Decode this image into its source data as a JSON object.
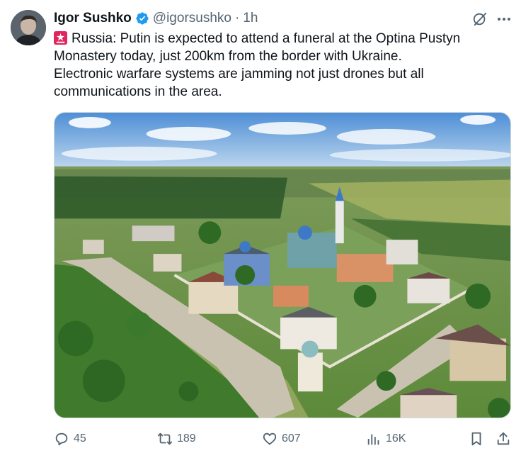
{
  "author": {
    "name": "Igor Sushko",
    "handle": "@igorsushko",
    "separator": "·",
    "time": "1h"
  },
  "tweet": {
    "lines": [
      "Russia: Putin is expected to attend a funeral at the Optina Pustyn",
      "Monastery today, just 200km from the border with Ukraine.",
      "Electronic warfare systems are jamming not just drones but all",
      "communications in the area."
    ]
  },
  "media": {
    "kind": "photo"
  },
  "actions": {
    "replies": "45",
    "reposts": "189",
    "likes": "607",
    "views": "16K"
  },
  "icons": {
    "verified": "verified-badge-icon",
    "siren": "rotating-light-emoji-icon",
    "grok": "grok-icon",
    "more": "more-dots-icon",
    "reply": "reply-icon",
    "repost": "repost-icon",
    "like": "heart-icon",
    "views": "views-chart-icon",
    "bookmark": "bookmark-icon",
    "share": "share-icon"
  },
  "colors": {
    "text": "#0f1419",
    "secondary": "#536471",
    "verified": "#1d9bf0"
  }
}
